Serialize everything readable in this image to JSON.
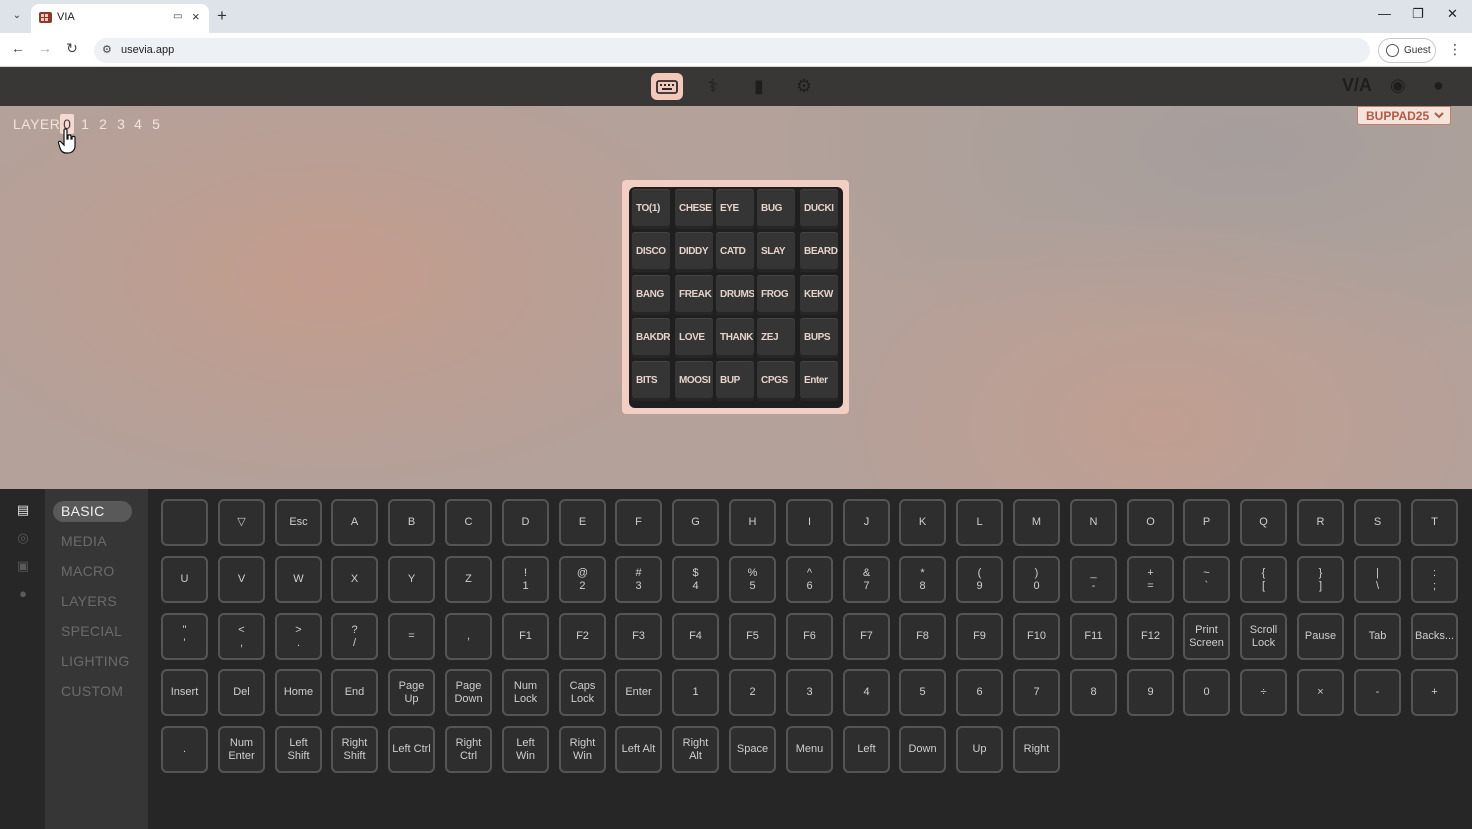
{
  "browser": {
    "tab_title": "VIA",
    "url": "usevia.app",
    "profile_label": "Guest",
    "new_tab_icon": "+",
    "close_tab_icon": "×"
  },
  "header": {
    "icons": [
      "keyboard-icon",
      "debug-icon",
      "design-icon",
      "settings-icon"
    ],
    "right_icons": [
      "via-logo",
      "discord-icon",
      "github-icon"
    ],
    "via_text": "V/A"
  },
  "layers": {
    "label": "LAYER",
    "items": [
      "0",
      "1",
      "2",
      "3",
      "4",
      "5"
    ],
    "selected": "0"
  },
  "device_selector": {
    "label": "BUPPAD25",
    "chevron": "⌄"
  },
  "keyboard_keys": [
    [
      "TO(1)",
      "CHESE",
      "EYE",
      "BUG",
      "DUCKI"
    ],
    [
      "DISCO",
      "DIDDY",
      "CATD",
      "SLAY",
      "BEARD"
    ],
    [
      "BANG",
      "FREAK",
      "DRUMS",
      "FROG",
      "KEKW"
    ],
    [
      "BAKDR",
      "LOVE",
      "THANK",
      "ZEJ",
      "BUPS"
    ],
    [
      "BITS",
      "MOOSI",
      "BUP",
      "CPGS",
      "Enter"
    ]
  ],
  "sidebar": {
    "icons": [
      "keycap-icon",
      "lighting-icon",
      "save-icon",
      "bulb-icon"
    ],
    "menu": [
      "BASIC",
      "MEDIA",
      "MACRO",
      "LAYERS",
      "SPECIAL",
      "LIGHTING",
      "CUSTOM"
    ],
    "selected": "BASIC"
  },
  "keycodes": [
    [
      "",
      "▽",
      "Esc",
      "A",
      "B",
      "C",
      "D",
      "E",
      "F",
      "G",
      "H",
      "I",
      "J",
      "K",
      "L",
      "M",
      "N",
      "O",
      "P",
      "Q",
      "R",
      "S",
      "T"
    ],
    [
      "U",
      "V",
      "W",
      "X",
      "Y",
      "Z",
      "!\n1",
      "@\n2",
      "#\n3",
      "$\n4",
      "%\n5",
      "^\n6",
      "&\n7",
      "*\n8",
      "(\n9",
      ")\n0",
      "_\n-",
      "+\n=",
      "~\n`",
      "{\n[",
      "}\n]",
      "|\n\\",
      ":\n;"
    ],
    [
      "\"\n'",
      "<\n,",
      ">\n.",
      "?\n/",
      "=",
      ",",
      "F1",
      "F2",
      "F3",
      "F4",
      "F5",
      "F6",
      "F7",
      "F8",
      "F9",
      "F10",
      "F11",
      "F12",
      "Print\nScreen",
      "Scroll\nLock",
      "Pause",
      "Tab",
      "Backs..."
    ],
    [
      "Insert",
      "Del",
      "Home",
      "End",
      "Page\nUp",
      "Page\nDown",
      "Num\nLock",
      "Caps\nLock",
      "Enter",
      "1",
      "2",
      "3",
      "4",
      "5",
      "6",
      "7",
      "8",
      "9",
      "0",
      "÷",
      "×",
      "-",
      "+"
    ],
    [
      ".",
      "Num\nEnter",
      "Left\nShift",
      "Right\nShift",
      "Left Ctrl",
      "Right\nCtrl",
      "Left\nWin",
      "Right\nWin",
      "Left Alt",
      "Right\nAlt",
      "Space",
      "Menu",
      "Left",
      "Down",
      "Up",
      "Right"
    ]
  ],
  "colors": {
    "accent": "#f3c7b9",
    "header_bg": "#393736",
    "panel_bg": "#262626"
  }
}
